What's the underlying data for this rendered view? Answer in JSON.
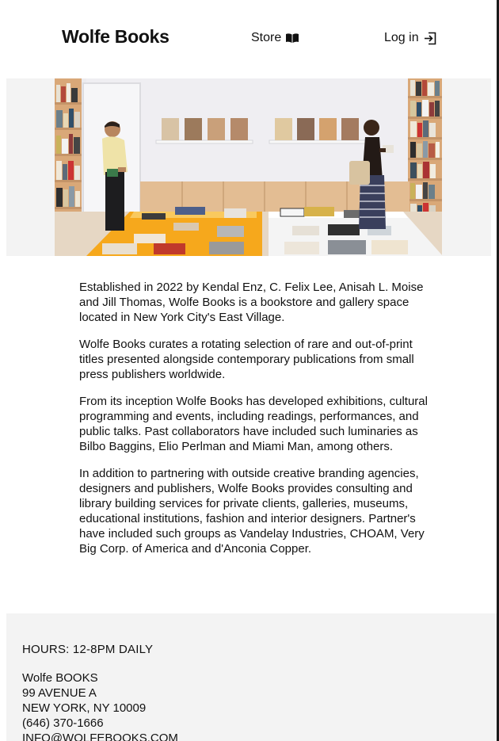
{
  "header": {
    "brand": "Wolfe Books",
    "nav": {
      "store_label": "Store",
      "store_icon": "open-book-icon",
      "login_label": "Log in",
      "login_icon": "login-arrow-icon"
    }
  },
  "hero": {
    "image": "bookstore-interior-photo"
  },
  "about": {
    "paragraphs": [
      "Established in 2022 by Kendal Enz, C. Felix Lee, Anisah L. Moise and Jill Thomas, Wolfe Books is a bookstore and gallery space located in New York City's East Village.",
      "Wolfe Books curates a rotating selection of rare and out-of-print titles presented alongside contemporary publications from small press publishers worldwide.",
      "From its inception Wolfe Books has developed exhibitions, cultural programming and events, including readings, performances, and public talks. Past collaborators have included such luminaries as Bilbo Baggins, Elio Perlman and Miami Man, among others.",
      "In addition to partnering with outside creative branding agencies, designers and publishers, Wolfe Books provides consulting and library building services for private clients, galleries, museums, educational institutions, fashion and interior designers. Partner's have included such groups as Vandelay Industries, CHOAM, Very Big Corp. of America and d'Anconia Copper."
    ]
  },
  "footer": {
    "hours": "HOURS: 12-8PM DAILY",
    "address_lines": [
      "Wolfe BOOKS",
      "99 AVENUE A",
      "NEW YORK, NY 10009",
      "(646) 370-1666",
      "INFO@WOLFEBOOKS.COM"
    ]
  },
  "colors": {
    "text": "#111111",
    "band_background": "#f3f3f3",
    "accent_orange": "#f6a81c"
  }
}
